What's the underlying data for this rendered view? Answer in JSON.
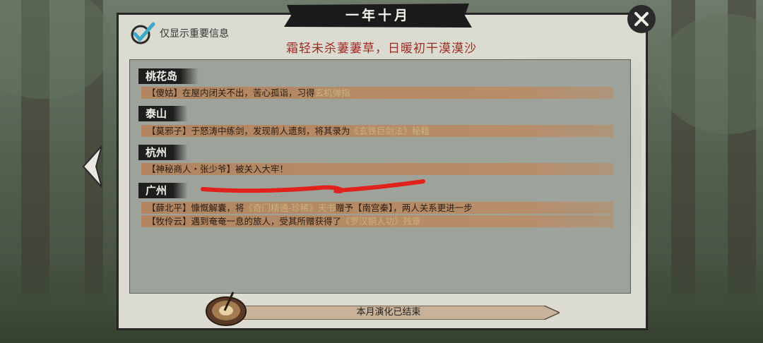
{
  "window": {
    "title": "一年十月",
    "close_icon": "close-x-icon"
  },
  "filter": {
    "label": "仅显示重要信息",
    "checked": true
  },
  "poem": "霜轻未杀萋萋草，日暖初干漠漠沙",
  "regions": [
    {
      "name": "桃花岛",
      "events": [
        {
          "parts": [
            "【傻姑】在屋内闭关不出，苦心孤诣，习得",
            "玄机弹指",
            ""
          ]
        }
      ]
    },
    {
      "name": "泰山",
      "events": [
        {
          "parts": [
            "【莫邪子】于怒涛中练剑，发现前人遗刻，将其录为",
            "《玄铁巨剑法》秘籍",
            ""
          ]
        }
      ]
    },
    {
      "name": "杭州",
      "events": [
        {
          "parts": [
            "【神秘商人・张少爷】被关入大牢！",
            "",
            ""
          ]
        }
      ]
    },
    {
      "name": "广州",
      "events": [
        {
          "parts": [
            "【薛北平】慷慨解囊，将",
            "《奇门精通-珍稀》天书",
            "赠予【南宫秦】，两人关系更进一步"
          ]
        },
        {
          "parts": [
            "【牧伶云】遇到奄奄一息的旅人，受其所赠获得了",
            "《罗汉铜人功》残章",
            ""
          ]
        }
      ]
    }
  ],
  "footer": {
    "status": "本月演化已结束"
  },
  "colors": {
    "poem": "#9e2b22",
    "highlight": "#c8b37a",
    "event_bg": "#b8896a",
    "panel_bg": "#dcdbd1",
    "list_bg": "#9da29a"
  }
}
